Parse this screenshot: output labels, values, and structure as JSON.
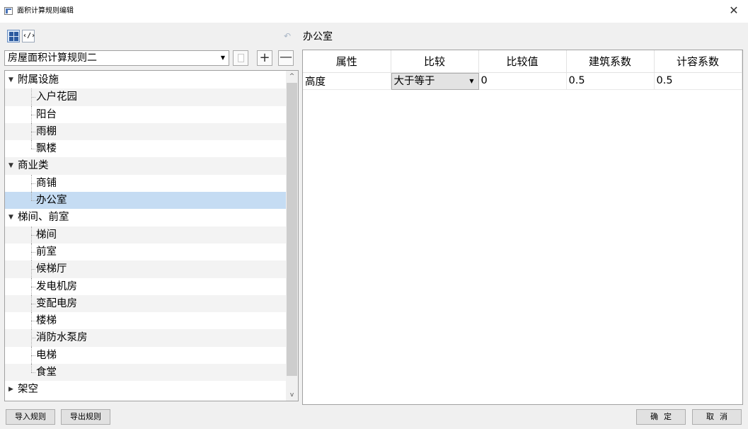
{
  "window": {
    "title": "面积计算规则编辑",
    "close_glyph": "✕"
  },
  "toolbar": {
    "view_code_glyph": "‹/›",
    "undo_glyph": "↶"
  },
  "rule_select": {
    "value": "房屋面积计算规则二",
    "arrow": "▼",
    "add_glyph": "+",
    "remove_glyph": "—"
  },
  "tree": {
    "categories": [
      {
        "label": "附属设施",
        "expanded": true,
        "items": [
          "入户花园",
          "阳台",
          "雨棚",
          "飘楼"
        ]
      },
      {
        "label": "商业类",
        "expanded": true,
        "items": [
          "商铺",
          "办公室"
        ]
      },
      {
        "label": "梯间、前室",
        "expanded": true,
        "items": [
          "梯间",
          "前室",
          "候梯厅",
          "发电机房",
          "变配电房",
          "楼梯",
          "消防水泵房",
          "电梯",
          "食堂"
        ]
      },
      {
        "label": "架空",
        "expanded": false,
        "items": []
      }
    ],
    "selected_item": "办公室",
    "expanded_glyph": "▼",
    "collapsed_glyph": "▶",
    "scroll_up_glyph": "^",
    "scroll_down_glyph": "v"
  },
  "detail": {
    "title": "办公室",
    "columns": [
      "属性",
      "比较",
      "比较值",
      "建筑系数",
      "计容系数"
    ],
    "rows": [
      {
        "attribute": "高度",
        "compare": "大于等于",
        "value": "0",
        "building_coef": "0.5",
        "plot_coef": "0.5"
      }
    ],
    "compare_arrow": "▼"
  },
  "footer": {
    "import_label": "导入规则",
    "export_label": "导出规则",
    "ok_label": "确定",
    "cancel_label": "取消"
  },
  "colors": {
    "selection": "#c5dcf3",
    "accent": "#2b5aa0"
  }
}
